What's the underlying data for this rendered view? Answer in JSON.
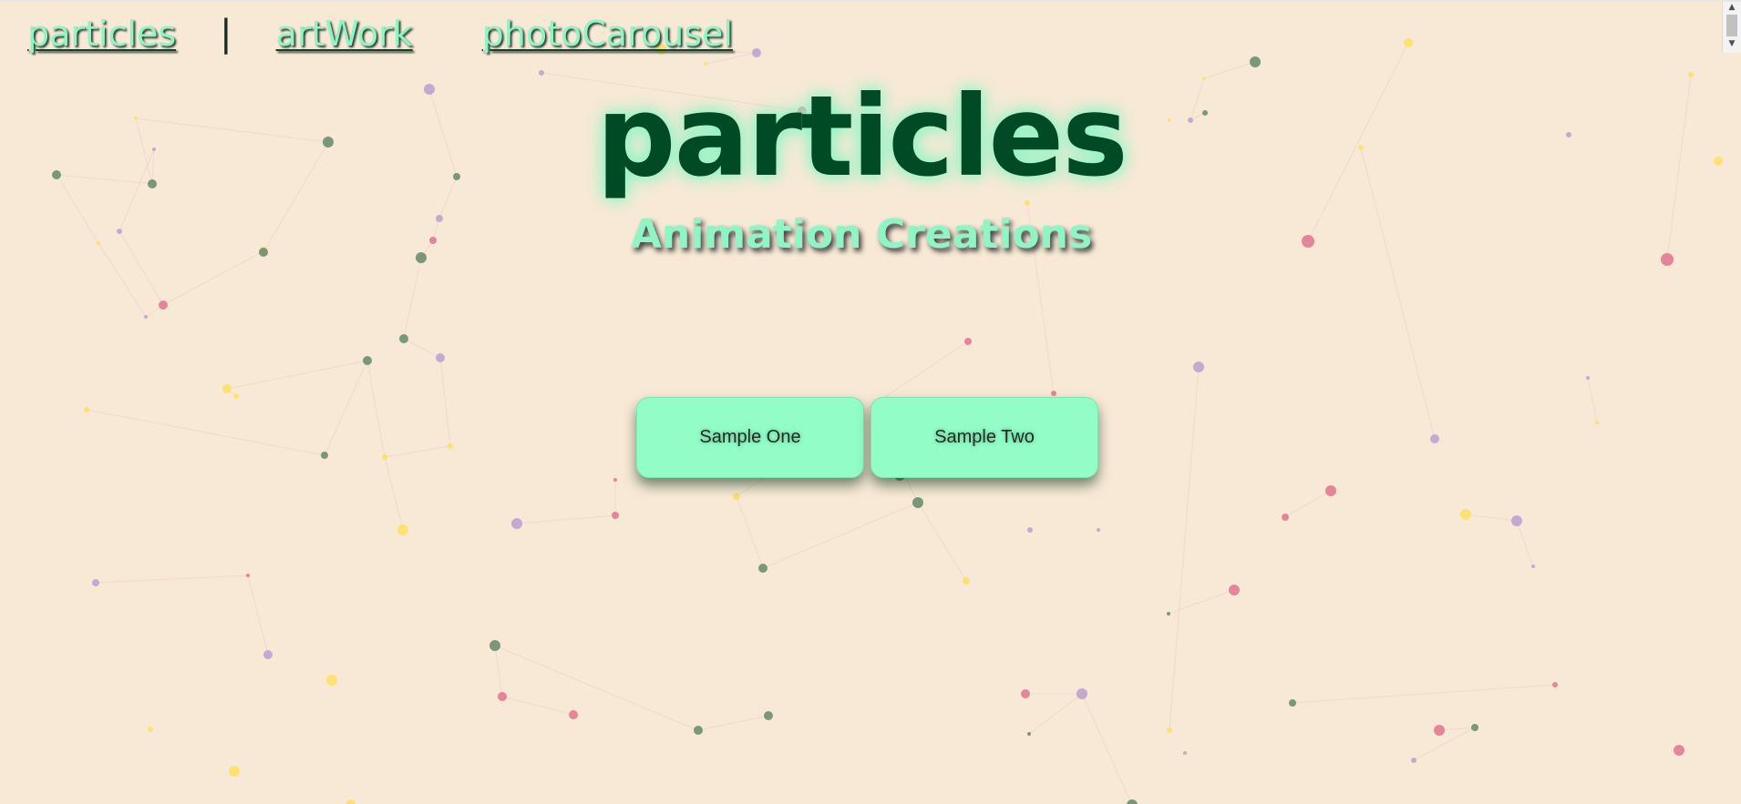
{
  "nav": {
    "links": [
      "particles",
      "artWork",
      "photoCarousel"
    ],
    "separator": "|"
  },
  "hero": {
    "title": "particles",
    "subtitle": "Animation Creations"
  },
  "buttons": {
    "sample_one": "Sample One",
    "sample_two": "Sample Two"
  },
  "colors": {
    "background": "#f8e9d6",
    "accent": "#92fdc7",
    "title": "#004a26",
    "particle_green": "#6a8f70",
    "particle_pink": "#e27a94",
    "particle_purple": "#bfa2cf",
    "particle_yellow": "#fde067"
  },
  "icons": {
    "scroll_up": "triangle-up-icon",
    "scroll_down": "triangle-down-icon"
  }
}
